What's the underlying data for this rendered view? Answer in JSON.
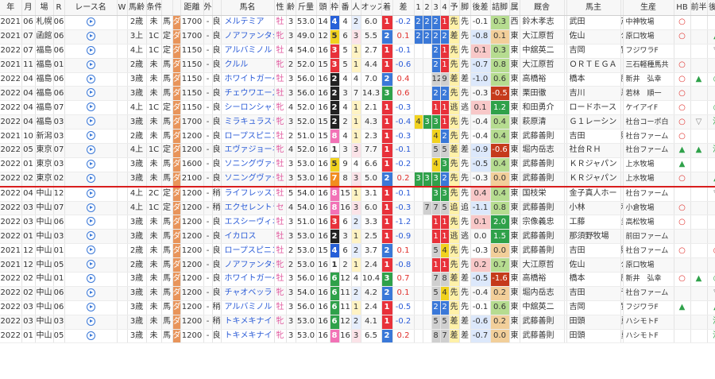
{
  "headers": [
    "年",
    "月",
    "場",
    "R",
    "レース名",
    "W",
    "馬齢",
    "条件",
    "",
    "",
    "距離",
    "外",
    "",
    "馬名",
    "性",
    "齢",
    "斤量",
    "頭",
    "枠",
    "番",
    "人",
    "オッズ",
    "着",
    "差",
    "1",
    "2",
    "3",
    "4",
    "予",
    "脚",
    "後差",
    "詰脚",
    "属",
    "厩舎",
    "",
    "馬主",
    "",
    "生産",
    "HB",
    "前半",
    "後半"
  ],
  "rows": [
    {
      "y": "2021",
      "m": "06",
      "p": "札幌",
      "r": "06",
      "age": "2歳",
      "cond": "未",
      "kind": "馬",
      "surf": "ダ",
      "dist": "1700",
      "out": "-",
      "cond2": "良",
      "horse": "メルテミア",
      "sex": "牡",
      "a": "3",
      "kin": "53.0",
      "hd": "14",
      "waku": "4",
      "ban": "4",
      "ninki": "2",
      "odds": "6.0",
      "chaku": "1",
      "sa": "-0.2",
      "c1": "2",
      "c2": "2",
      "c3": "2",
      "c4": "1",
      "yo": "先",
      "kyaku": "先",
      "go": "-0.1",
      "tsume": "0.3",
      "zoku": "西",
      "kyu1": "鈴木孝志",
      "kyu2": "",
      "own": "武田",
      "own2": "茂男",
      "sei": "中神牧場",
      "hb": "",
      "zen": "",
      "kou": ""
    },
    {
      "y": "2021",
      "m": "07",
      "p": "函館",
      "r": "06",
      "age": "3上",
      "cond": "1C",
      "kind": "定",
      "surf": "ダ",
      "dist": "1700",
      "out": "-",
      "cond2": "良",
      "horse": "ノアファンタジー",
      "sex": "牝",
      "a": "3",
      "kin": "49.0",
      "hd": "12",
      "waku": "5",
      "ban": "6",
      "ninki": "3",
      "odds": "5.5",
      "chaku": "2",
      "sa": "0.1",
      "c1": "2",
      "c2": "2",
      "c3": "2",
      "c4": "2",
      "yo": "差",
      "kyaku": "先",
      "go": "-0.8",
      "tsume": "0.1",
      "zoku": "東",
      "kyu1": "大江原哲",
      "kyu2": "",
      "own": "佐山",
      "own2": "公男",
      "sei": "原口牧場",
      "hb": "",
      "zen": "",
      "kou": "▲"
    },
    {
      "y": "2022",
      "m": "07",
      "p": "福島",
      "r": "06",
      "age": "4上",
      "cond": "1C",
      "kind": "定",
      "surf": "ダ",
      "dist": "1150",
      "out": "-",
      "cond2": "良",
      "horse": "アルバミノル",
      "sex": "牡",
      "a": "4",
      "kin": "54.0",
      "hd": "16",
      "waku": "3",
      "ban": "5",
      "ninki": "1",
      "odds": "2.7",
      "chaku": "1",
      "sa": "-0.1",
      "c1": "",
      "c2": "",
      "c3": "2",
      "c4": "1",
      "yo": "先",
      "kyaku": "先",
      "go": "0.1",
      "tsume": "0.3",
      "zoku": "東",
      "kyu1": "中舘英二",
      "kyu2": "",
      "own": "吉岡",
      "own2": "實",
      "sei": "フジワラF",
      "hb": "",
      "zen": "",
      "kou": "▽"
    },
    {
      "y": "2021",
      "m": "11",
      "p": "福島",
      "r": "01",
      "age": "2歳",
      "cond": "未",
      "kind": "馬",
      "surf": "ダ",
      "dist": "1150",
      "out": "-",
      "cond2": "良",
      "horse": "クルル",
      "sex": "牝",
      "a": "2",
      "kin": "52.0",
      "hd": "15",
      "waku": "3",
      "ban": "5",
      "ninki": "1",
      "odds": "4.4",
      "chaku": "1",
      "sa": "-0.6",
      "c1": "",
      "c2": "",
      "c3": "2",
      "c4": "1",
      "yo": "先",
      "kyaku": "先",
      "go": "-0.7",
      "tsume": "0.8",
      "zoku": "東",
      "kyu1": "大江原哲",
      "kyu2": "",
      "own": "ＯＲＴＥＧＡ",
      "own2": "",
      "sei": "三石軽種馬共",
      "hb": "",
      "zen": "",
      "kou": ""
    },
    {
      "y": "2022",
      "m": "04",
      "p": "福島",
      "r": "06",
      "age": "3歳",
      "cond": "未",
      "kind": "馬",
      "surf": "ダ",
      "dist": "1150",
      "out": "-",
      "cond2": "良",
      "horse": "ホワイトガーベラ",
      "sex": "牡",
      "a": "3",
      "kin": "56.0",
      "hd": "16",
      "waku": "2",
      "ban": "4",
      "ninki": "4",
      "odds": "7.0",
      "chaku": "2",
      "sa": "0.4",
      "c1": "",
      "c2": "",
      "c3": "12",
      "c4": "9",
      "yo": "差",
      "kyaku": "差",
      "go": "-1.0",
      "tsume": "0.6",
      "zoku": "東",
      "kyu1": "高橋裕",
      "kyu2": "",
      "own": "橋本",
      "own2": "勝美",
      "sei": "新井　弘幸",
      "hb": "",
      "zen": "▲",
      "kou": "◎"
    },
    {
      "y": "2022",
      "m": "04",
      "p": "福島",
      "r": "06",
      "age": "3歳",
      "cond": "未",
      "kind": "馬",
      "surf": "ダ",
      "dist": "1150",
      "out": "-",
      "cond2": "良",
      "horse": "チェウワエース",
      "sex": "牡",
      "a": "3",
      "kin": "56.0",
      "hd": "16",
      "waku": "2",
      "ban": "3",
      "ninki": "7",
      "odds": "14.3",
      "chaku": "3",
      "sa": "0.6",
      "c1": "",
      "c2": "",
      "c3": "2",
      "c4": "2",
      "yo": "先",
      "kyaku": "先",
      "go": "-0.3",
      "tsume": "-0.5",
      "zoku": "東",
      "kyu1": "栗田徹",
      "kyu2": "",
      "own": "吉川",
      "own2": "忍",
      "sei": "若林　順一",
      "hb": "",
      "zen": "",
      "kou": ""
    },
    {
      "y": "2022",
      "m": "04",
      "p": "福島",
      "r": "07",
      "age": "4上",
      "cond": "1C",
      "kind": "定",
      "surf": "ダ",
      "dist": "1150",
      "out": "-",
      "cond2": "良",
      "horse": "シーロンシャン",
      "sex": "牝",
      "a": "4",
      "kin": "52.0",
      "hd": "16",
      "waku": "2",
      "ban": "4",
      "ninki": "1",
      "odds": "2.1",
      "chaku": "1",
      "sa": "-0.3",
      "c1": "",
      "c2": "",
      "c3": "1",
      "c4": "1",
      "yo": "逃",
      "kyaku": "逃",
      "go": "0.1",
      "tsume": "1.2",
      "zoku": "東",
      "kyu1": "和田勇介",
      "kyu2": "",
      "own": "ロードホース",
      "own2": "",
      "sei": "ケイアイF",
      "hb": "",
      "zen": "",
      "kou": "◎"
    },
    {
      "y": "2022",
      "m": "04",
      "p": "福島",
      "r": "03",
      "age": "3歳",
      "cond": "未",
      "kind": "馬",
      "surf": "ダ",
      "dist": "1700",
      "out": "-",
      "cond2": "良",
      "horse": "ミラキュラスライト",
      "sex": "牝",
      "a": "3",
      "kin": "52.0",
      "hd": "15",
      "waku": "2",
      "ban": "2",
      "ninki": "1",
      "odds": "4.3",
      "chaku": "1",
      "sa": "-0.4",
      "c1": "4",
      "c2": "3",
      "c3": "3",
      "c4": "1",
      "yo": "先",
      "kyaku": "先",
      "go": "-0.4",
      "tsume": "0.4",
      "zoku": "東",
      "kyu1": "萩原清",
      "kyu2": "",
      "own": "Ｇ１レーシン",
      "own2": "",
      "sei": "社台コーポ白",
      "hb": "",
      "zen": "▽",
      "kou": "注"
    },
    {
      "y": "2021",
      "m": "10",
      "p": "新潟",
      "r": "03",
      "age": "2歳",
      "cond": "未",
      "kind": "馬",
      "surf": "ダ",
      "dist": "1200",
      "out": "-",
      "cond2": "良",
      "horse": "ロープスピニング",
      "sex": "牡",
      "a": "2",
      "kin": "51.0",
      "hd": "15",
      "waku": "8",
      "ban": "4",
      "ninki": "1",
      "odds": "2.3",
      "chaku": "1",
      "sa": "-0.3",
      "c1": "",
      "c2": "",
      "c3": "4",
      "c4": "2",
      "yo": "先",
      "kyaku": "先",
      "go": "-0.4",
      "tsume": "0.4",
      "zoku": "東",
      "kyu1": "武藤善則",
      "kyu2": "",
      "own": "吉田",
      "own2": "照哉",
      "sei": "社台ファーム",
      "hb": "",
      "zen": "",
      "kou": ""
    },
    {
      "y": "2022",
      "m": "05",
      "p": "東京",
      "r": "07",
      "age": "4上",
      "cond": "1C",
      "kind": "定",
      "surf": "ダ",
      "dist": "1200",
      "out": "-",
      "cond2": "良",
      "horse": "エヴァジョーネ",
      "sex": "牝",
      "a": "4",
      "kin": "52.0",
      "hd": "16",
      "waku": "1",
      "ban": "3",
      "ninki": "3",
      "odds": "7.7",
      "chaku": "1",
      "sa": "-0.1",
      "c1": "",
      "c2": "",
      "c3": "5",
      "c4": "5",
      "yo": "差",
      "kyaku": "差",
      "go": "-0.9",
      "tsume": "-0.6",
      "zoku": "東",
      "kyu1": "堀内岳志",
      "kyu2": "",
      "own": "社台ＲＨ",
      "own2": "",
      "sei": "社台ファーム",
      "hb": "",
      "zen": "▲",
      "kou": "注"
    },
    {
      "y": "2022",
      "m": "01",
      "p": "東京",
      "r": "03",
      "age": "3歳",
      "cond": "未",
      "kind": "馬",
      "surf": "ダ",
      "dist": "1600",
      "out": "-",
      "cond2": "良",
      "horse": "ソニングヴァース",
      "sex": "牡",
      "a": "3",
      "kin": "53.0",
      "hd": "16",
      "waku": "5",
      "ban": "9",
      "ninki": "4",
      "odds": "6.6",
      "chaku": "1",
      "sa": "-0.2",
      "c1": "",
      "c2": "",
      "c3": "4",
      "c4": "3",
      "yo": "先",
      "kyaku": "先",
      "go": "-0.5",
      "tsume": "0.4",
      "zoku": "東",
      "kyu1": "武藤善則",
      "kyu2": "",
      "own": "ＫＲジャパン",
      "own2": "",
      "sei": "上水牧場",
      "hb": "",
      "zen": "",
      "kou": ""
    },
    {
      "y": "2022",
      "m": "02",
      "p": "東京",
      "r": "02",
      "age": "3歳",
      "cond": "未",
      "kind": "馬",
      "surf": "ダ",
      "dist": "2100",
      "out": "-",
      "cond2": "良",
      "horse": "ソニングヴァース",
      "sex": "牡",
      "a": "3",
      "kin": "53.0",
      "hd": "16",
      "waku": "7",
      "ban": "8",
      "ninki": "3",
      "odds": "5.0",
      "chaku": "2",
      "sa": "0.2",
      "c1": "3",
      "c2": "3",
      "c3": "3",
      "c4": "2",
      "yo": "先",
      "kyaku": "先",
      "go": "-0.3",
      "tsume": "0.0",
      "zoku": "東",
      "kyu1": "武藤善則",
      "kyu2": "",
      "own": "ＫＲジャパン",
      "own2": "",
      "sei": "上水牧場",
      "hb": "",
      "zen": "",
      "kou": "▲"
    },
    {
      "y": "2022",
      "m": "04",
      "p": "中山",
      "r": "12",
      "age": "4上",
      "cond": "2C",
      "kind": "定",
      "surf": "ダ",
      "dist": "1200",
      "out": "-",
      "cond2": "稍",
      "horse": "ライフレッスンズ",
      "sex": "牡",
      "a": "5",
      "kin": "54.0",
      "hd": "16",
      "waku": "8",
      "ban": "15",
      "ninki": "1",
      "odds": "3.1",
      "chaku": "1",
      "sa": "-0.1",
      "c1": "",
      "c2": "",
      "c3": "3",
      "c4": "3",
      "yo": "先",
      "kyaku": "先",
      "go": "0.4",
      "tsume": "0.4",
      "zoku": "東",
      "kyu1": "国枝栄",
      "kyu2": "",
      "own": "金子真人ホー",
      "own2": "",
      "sei": "社台ファーム",
      "hb": "",
      "zen": "",
      "kou": "▽"
    },
    {
      "y": "2022",
      "m": "03",
      "p": "中山",
      "r": "07",
      "age": "4上",
      "cond": "1C",
      "kind": "定",
      "surf": "ダ",
      "dist": "1200",
      "out": "-",
      "cond2": "稍",
      "horse": "エクセレントラン",
      "sex": "セ",
      "a": "4",
      "kin": "54.0",
      "hd": "16",
      "waku": "8",
      "ban": "16",
      "ninki": "3",
      "odds": "6.0",
      "chaku": "1",
      "sa": "-0.3",
      "c1": "",
      "c2": "7",
      "c3": "7",
      "c4": "5",
      "yo": "追",
      "kyaku": "追",
      "go": "-1.1",
      "tsume": "0.8",
      "zoku": "東",
      "kyu1": "武藤善則",
      "kyu2": "",
      "own": "小林",
      "own2": "利彦",
      "sei": "小倉牧場",
      "hb": "",
      "zen": "",
      "kou": ""
    },
    {
      "y": "2022",
      "m": "03",
      "p": "中山",
      "r": "06",
      "age": "3歳",
      "cond": "未",
      "kind": "馬",
      "surf": "ダ",
      "dist": "1200",
      "out": "-",
      "cond2": "良",
      "horse": "エスシーヴィオラ",
      "sex": "牡",
      "a": "3",
      "kin": "51.0",
      "hd": "16",
      "waku": "3",
      "ban": "6",
      "ninki": "2",
      "odds": "3.3",
      "chaku": "1",
      "sa": "-1.2",
      "c1": "",
      "c2": "",
      "c3": "1",
      "c4": "1",
      "yo": "先",
      "kyaku": "先",
      "go": "0.1",
      "tsume": "2.0",
      "zoku": "東",
      "kyu1": "宗像義忠",
      "kyu2": "",
      "own": "工藤",
      "own2": "圭司",
      "sei": "高松牧場",
      "hb": "",
      "zen": "",
      "kou": ""
    },
    {
      "y": "2022",
      "m": "01",
      "p": "中山",
      "r": "03",
      "age": "3歳",
      "cond": "未",
      "kind": "馬",
      "surf": "ダ",
      "dist": "1200",
      "out": "-",
      "cond2": "良",
      "horse": "イカロス",
      "sex": "牡",
      "a": "3",
      "kin": "53.0",
      "hd": "16",
      "waku": "2",
      "ban": "3",
      "ninki": "1",
      "odds": "2.5",
      "chaku": "1",
      "sa": "-0.9",
      "c1": "",
      "c2": "",
      "c3": "1",
      "c4": "1",
      "yo": "逃",
      "kyaku": "逃",
      "go": "0.0",
      "tsume": "1.5",
      "zoku": "東",
      "kyu1": "武藤善則",
      "kyu2": "",
      "own": "那須野牧場",
      "own2": "",
      "sei": "前田ファーム",
      "hb": "",
      "zen": "",
      "kou": ""
    },
    {
      "y": "2021",
      "m": "12",
      "p": "中山",
      "r": "01",
      "age": "2歳",
      "cond": "未",
      "kind": "馬",
      "surf": "ダ",
      "dist": "1200",
      "out": "-",
      "cond2": "良",
      "horse": "ロープスピニング",
      "sex": "牡",
      "a": "2",
      "kin": "53.0",
      "hd": "15",
      "waku": "4",
      "ban": "6",
      "ninki": "2",
      "odds": "3.7",
      "chaku": "2",
      "sa": "0.1",
      "c1": "",
      "c2": "",
      "c3": "5",
      "c4": "4",
      "yo": "先",
      "kyaku": "先",
      "go": "-0.3",
      "tsume": "0.0",
      "zoku": "東",
      "kyu1": "武藤善則",
      "kyu2": "",
      "own": "吉田",
      "own2": "照哉",
      "sei": "社台ファーム",
      "hb": "",
      "zen": "",
      "kou": "○"
    },
    {
      "y": "2021",
      "m": "12",
      "p": "中山",
      "r": "05",
      "age": "2歳",
      "cond": "未",
      "kind": "馬",
      "surf": "ダ",
      "dist": "1200",
      "out": "-",
      "cond2": "良",
      "horse": "ノアファンタジー",
      "sex": "牝",
      "a": "2",
      "kin": "53.0",
      "hd": "16",
      "waku": "1",
      "ban": "2",
      "ninki": "1",
      "odds": "2.4",
      "chaku": "1",
      "sa": "-0.8",
      "c1": "",
      "c2": "",
      "c3": "1",
      "c4": "1",
      "yo": "先",
      "kyaku": "先",
      "go": "0.2",
      "tsume": "0.7",
      "zoku": "東",
      "kyu1": "大江原哲",
      "kyu2": "",
      "own": "佐山",
      "own2": "公男",
      "sei": "原口牧場",
      "hb": "",
      "zen": "",
      "kou": ""
    },
    {
      "y": "2022",
      "m": "02",
      "p": "中山",
      "r": "01",
      "age": "3歳",
      "cond": "未",
      "kind": "馬",
      "surf": "ダ",
      "dist": "1200",
      "out": "-",
      "cond2": "良",
      "horse": "ホワイトガーベラ",
      "sex": "牡",
      "a": "3",
      "kin": "56.0",
      "hd": "16",
      "waku": "6",
      "ban": "12",
      "ninki": "4",
      "odds": "10.4",
      "chaku": "3",
      "sa": "0.7",
      "c1": "",
      "c2": "",
      "c3": "7",
      "c4": "8",
      "yo": "差",
      "kyaku": "差",
      "go": "-0.5",
      "tsume": "-1.6",
      "zoku": "東",
      "kyu1": "高橋裕",
      "kyu2": "",
      "own": "橋本",
      "own2": "勝美",
      "sei": "新井　弘幸",
      "hb": "",
      "zen": "▲",
      "kou": "◎"
    },
    {
      "y": "2022",
      "m": "02",
      "p": "中山",
      "r": "06",
      "age": "3歳",
      "cond": "未",
      "kind": "馬",
      "surf": "ダ",
      "dist": "1200",
      "out": "-",
      "cond2": "良",
      "horse": "チャオベッラ",
      "sex": "牝",
      "a": "3",
      "kin": "54.0",
      "hd": "16",
      "waku": "6",
      "ban": "11",
      "ninki": "2",
      "odds": "4.2",
      "chaku": "2",
      "sa": "0.1",
      "c1": "",
      "c2": "",
      "c3": "5",
      "c4": "4",
      "yo": "先",
      "kyaku": "先",
      "go": "-0.4",
      "tsume": "0.2",
      "zoku": "東",
      "kyu1": "堀内岳志",
      "kyu2": "",
      "own": "吉田",
      "own2": "千津",
      "sei": "社台ファーム",
      "hb": "",
      "zen": "",
      "kou": "▽"
    },
    {
      "y": "2022",
      "m": "03",
      "p": "中山",
      "r": "06",
      "age": "3歳",
      "cond": "未",
      "kind": "馬",
      "surf": "ダ",
      "dist": "1200",
      "out": "-",
      "cond2": "稍",
      "horse": "アルバミノル",
      "sex": "牡",
      "a": "3",
      "kin": "56.0",
      "hd": "16",
      "waku": "6",
      "ban": "11",
      "ninki": "1",
      "odds": "2.4",
      "chaku": "1",
      "sa": "-0.5",
      "c1": "",
      "c2": "",
      "c3": "2",
      "c4": "2",
      "yo": "先",
      "kyaku": "先",
      "go": "-0.1",
      "tsume": "0.6",
      "zoku": "東",
      "kyu1": "中舘英二",
      "kyu2": "",
      "own": "吉岡",
      "own2": "實",
      "sei": "フジワラF",
      "hb": "",
      "zen": "",
      "kou": "▲"
    },
    {
      "y": "2022",
      "m": "03",
      "p": "中山",
      "r": "03",
      "age": "3歳",
      "cond": "未",
      "kind": "馬",
      "surf": "ダ",
      "dist": "1200",
      "out": "-",
      "cond2": "稍",
      "horse": "トキメキナイト",
      "sex": "牝",
      "a": "3",
      "kin": "53.0",
      "hd": "16",
      "waku": "6",
      "ban": "12",
      "ninki": "2",
      "odds": "4.1",
      "chaku": "1",
      "sa": "-0.2",
      "c1": "",
      "c2": "",
      "c3": "5",
      "c4": "5",
      "yo": "差",
      "kyaku": "差",
      "go": "-0.6",
      "tsume": "0.2",
      "zoku": "東",
      "kyu1": "武藤善則",
      "kyu2": "",
      "own": "田頭",
      "own2": "勇貴",
      "sei": "ハシモトF",
      "hb": "",
      "zen": "",
      "kou": "注"
    },
    {
      "y": "2022",
      "m": "01",
      "p": "中山",
      "r": "05",
      "age": "3歳",
      "cond": "未",
      "kind": "馬",
      "surf": "ダ",
      "dist": "1200",
      "out": "-",
      "cond2": "良",
      "horse": "トキメキナイト",
      "sex": "牝",
      "a": "3",
      "kin": "53.0",
      "hd": "16",
      "waku": "8",
      "ban": "16",
      "ninki": "3",
      "odds": "6.5",
      "chaku": "2",
      "sa": "0.2",
      "c1": "",
      "c2": "",
      "c3": "8",
      "c4": "7",
      "yo": "差",
      "kyaku": "差",
      "go": "-0.7",
      "tsume": "0.0",
      "zoku": "東",
      "kyu1": "武藤善則",
      "kyu2": "",
      "own": "田頭",
      "own2": "勇貴",
      "sei": "ハシモトF",
      "hb": "",
      "zen": "",
      "kou": "注"
    }
  ],
  "hb_marks": [
    "○",
    "○",
    "",
    "○",
    "○",
    "○",
    "○",
    "○",
    "○",
    "▲",
    "▲",
    "○",
    "",
    "○",
    "○",
    "",
    "○",
    "",
    "○",
    "",
    "▲",
    "",
    ""
  ],
  "zen_marks": [
    "",
    "",
    "",
    "",
    "",
    "",
    "",
    "",
    "",
    "",
    "",
    "",
    "",
    "",
    "",
    "",
    "",
    "",
    "",
    "",
    "",
    "",
    ""
  ],
  "separator_after_row": 11
}
